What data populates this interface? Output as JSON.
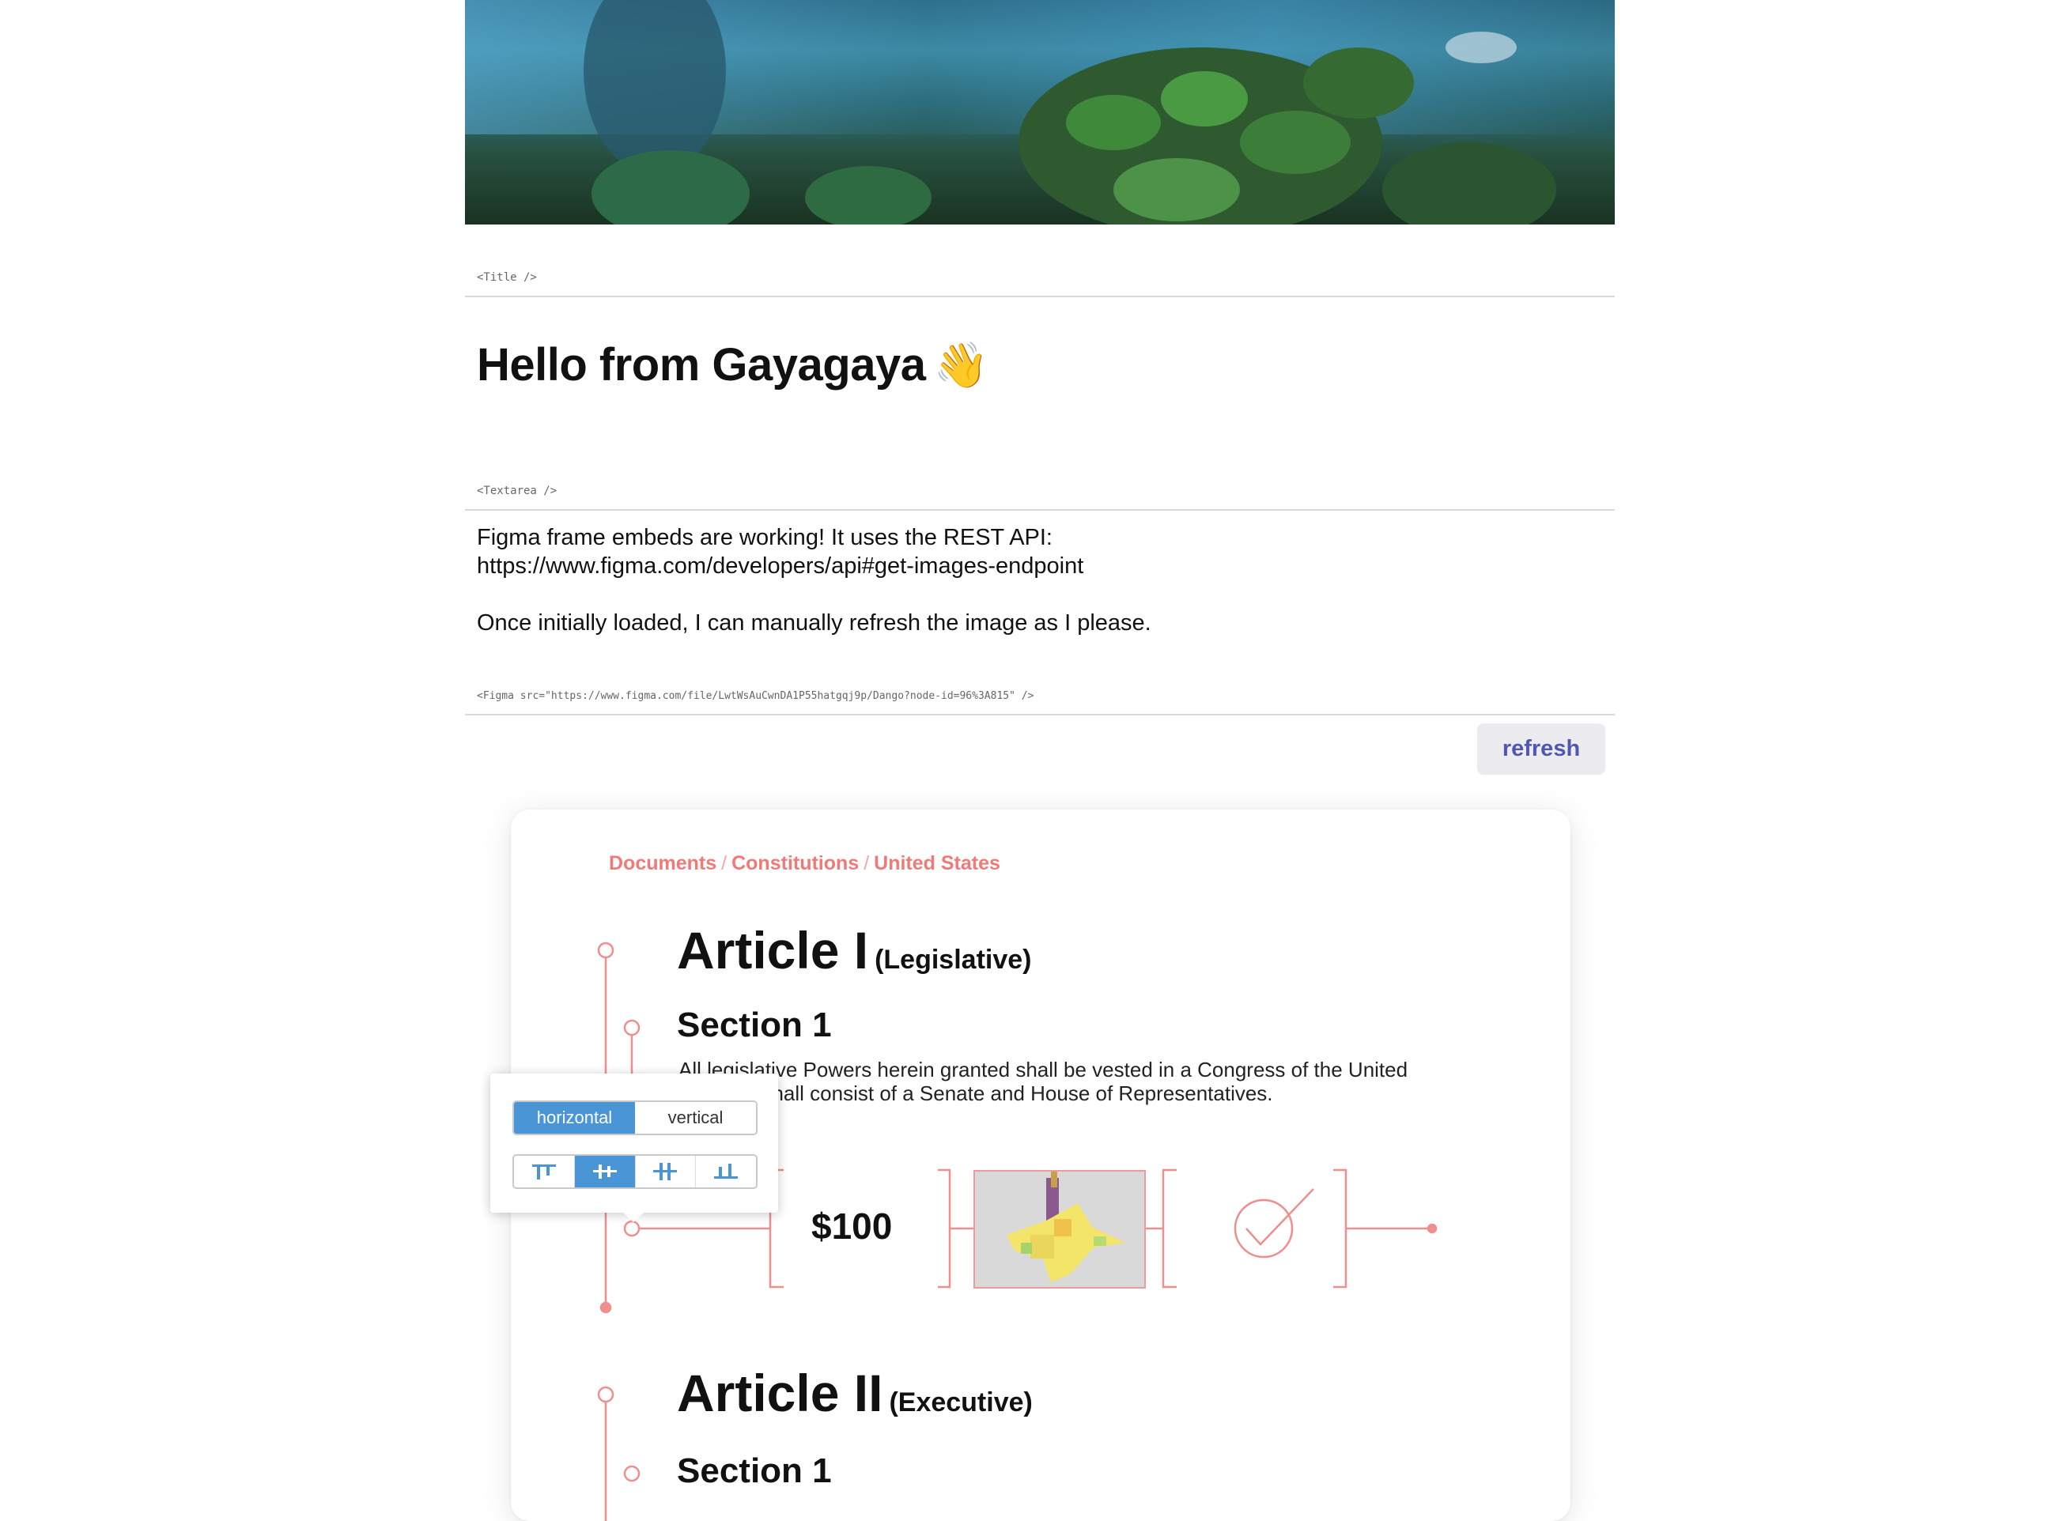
{
  "tags": {
    "title": "<Title />",
    "textarea": "<Textarea />",
    "figma": "<Figma src=\"https://www.figma.com/file/LwtWsAuCwnDA1P55hatgqj9p/Dango?node-id=96%3A815\" />"
  },
  "title": {
    "text": "Hello from Gayagaya",
    "emoji": "👋"
  },
  "textarea": {
    "line1": "Figma frame embeds are working! It uses the REST API:",
    "line2": "https://www.figma.com/developers/api#get-images-endpoint",
    "line3": "Once initially loaded, I can manually refresh the image as I please."
  },
  "refresh_label": "refresh",
  "figma_frame": {
    "breadcrumb": [
      "Documents",
      "Constitutions",
      "United States"
    ],
    "article1": {
      "title": "Article I",
      "sub": "(Legislative)"
    },
    "section1": "Section 1",
    "body": "All legislative Powers herein granted shall be vested in a Congress of the United\n         ich shall consist of a Senate and House of Representatives.",
    "price": "$100",
    "article2": {
      "title": "Article II",
      "sub": "(Executive)"
    },
    "section2": "Section 1",
    "toolbar": {
      "orientation_options": [
        "horizontal",
        "vertical"
      ],
      "selected_orientation": "horizontal",
      "align_icons": [
        "align-top-icon",
        "align-center-icon",
        "distribute-icon",
        "align-bottom-icon"
      ],
      "selected_align": "align-center-icon"
    },
    "accent_color": "#ef7a78",
    "toolbar_accent": "#4a95d6"
  }
}
